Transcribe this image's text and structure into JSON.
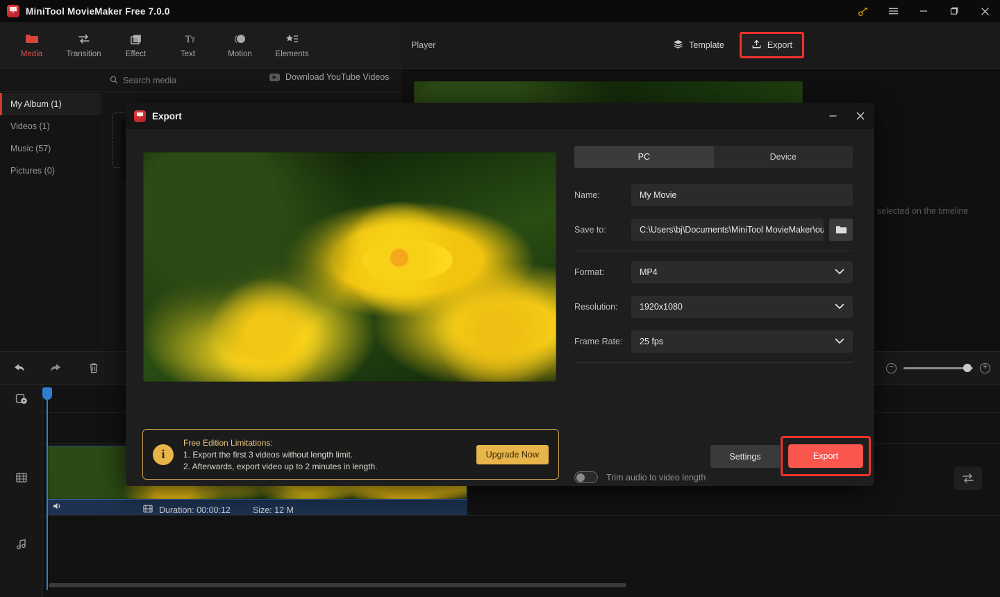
{
  "window": {
    "title": "MiniTool MovieMaker Free 7.0.0",
    "controls": [
      "key-icon",
      "menu-icon",
      "minimize-icon",
      "maximize-icon",
      "close-icon"
    ]
  },
  "nav": {
    "tabs": [
      {
        "label": "Media",
        "icon": "folder-icon",
        "active": true
      },
      {
        "label": "Transition",
        "icon": "transition-arrows-icon",
        "active": false
      },
      {
        "label": "Effect",
        "icon": "effect-layers-icon",
        "active": false
      },
      {
        "label": "Text",
        "icon": "text-icon",
        "active": false
      },
      {
        "label": "Motion",
        "icon": "motion-icon",
        "active": false
      },
      {
        "label": "Elements",
        "icon": "elements-star-icon",
        "active": false
      }
    ]
  },
  "media": {
    "search_placeholder": "Search media",
    "search_icon": "search-icon",
    "youtube_label": "Download YouTube Videos",
    "youtube_icon": "youtube-icon",
    "sidebar": [
      {
        "label": "My Album (1)",
        "active": true
      },
      {
        "label": "Videos (1)",
        "active": false
      },
      {
        "label": "Music (57)",
        "active": false
      },
      {
        "label": "Pictures (0)",
        "active": false
      }
    ]
  },
  "player": {
    "label": "Player",
    "template_label": "Template",
    "template_icon": "layers-icon",
    "export_label": "Export",
    "export_icon": "upload-icon",
    "behind_text": "selected on the timeline"
  },
  "timeline_toolbar": {
    "undo_icon": "undo-icon",
    "redo_icon": "redo-icon",
    "delete_icon": "trash-icon",
    "split_icon": "split-icon",
    "zoom_out_label": "−",
    "zoom_in_label": "+"
  },
  "timeline": {
    "tracks": [
      {
        "icon": "add-media-icon"
      },
      {
        "icon": "video-track-icon"
      },
      {
        "icon": "audio-track-icon"
      }
    ],
    "clip_audio_icon": "speaker-icon",
    "swap_icon": "swap-arrows-icon"
  },
  "dialog": {
    "title": "Export",
    "logo_icon": "app-logo-icon",
    "minimize_icon": "minimize-icon",
    "close_icon": "close-icon",
    "tabs": [
      {
        "label": "PC",
        "active": true
      },
      {
        "label": "Device",
        "active": false
      }
    ],
    "meta": {
      "film_icon": "film-icon",
      "duration_label": "Duration: 00:00:12",
      "size_label": "Size: 12 M"
    },
    "fields": {
      "name_label": "Name:",
      "name_value": "My Movie",
      "saveto_label": "Save to:",
      "saveto_value": "C:\\Users\\bj\\Documents\\MiniTool MovieMaker\\outp",
      "folder_icon": "folder-open-icon",
      "format_label": "Format:",
      "format_value": "MP4",
      "resolution_label": "Resolution:",
      "resolution_value": "1920x1080",
      "framerate_label": "Frame Rate:",
      "framerate_value": "25 fps",
      "chevron_icon": "chevron-down-icon"
    },
    "toggle": {
      "label": "Trim audio to video length",
      "on": false
    },
    "notice": {
      "icon": "info-icon",
      "title": "Free Edition Limitations:",
      "line1": "1. Export the first 3 videos without length limit.",
      "line2": "2. Afterwards, export video up to 2 minutes in length.",
      "upgrade_label": "Upgrade Now"
    },
    "actions": {
      "settings_label": "Settings",
      "export_label": "Export"
    }
  },
  "colors": {
    "accent_red": "#e0504a",
    "export_red": "#f9564d",
    "highlight_box": "#f0322b",
    "notice_gold": "#e8b54a",
    "playhead_blue": "#2f7fd0"
  }
}
